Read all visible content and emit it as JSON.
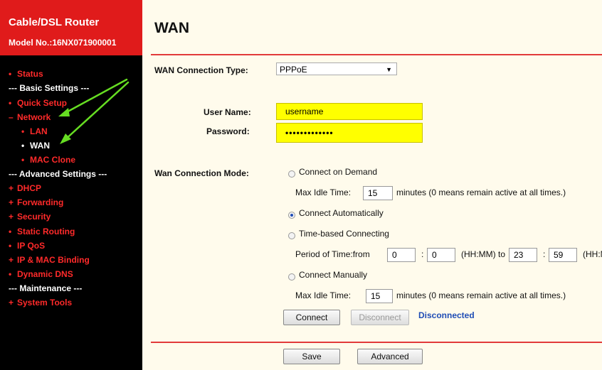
{
  "brand": {
    "title": "Cable/DSL Router",
    "model": "Model No.:16NX071900001"
  },
  "nav": {
    "status": "Status",
    "basic_header": "--- Basic Settings ---",
    "quick_setup": "Quick Setup",
    "network": "Network",
    "lan": "LAN",
    "wan": "WAN",
    "mac_clone": "MAC Clone",
    "advanced_header": "--- Advanced Settings ---",
    "dhcp": "DHCP",
    "forwarding": "Forwarding",
    "security": "Security",
    "static_routing": "Static Routing",
    "ip_qos": "IP QoS",
    "ip_mac_binding": "IP & MAC Binding",
    "dynamic_dns": "Dynamic DNS",
    "maintenance_header": "--- Maintenance ---",
    "system_tools": "System Tools"
  },
  "page": {
    "title": "WAN",
    "wan_type_label": "WAN Connection Type:",
    "wan_type_value": "PPPoE",
    "username_label": "User Name:",
    "username_value": "username",
    "password_label": "Password:",
    "password_value": "•••••••••••••",
    "mode_label": "Wan Connection Mode:",
    "connect_on_demand": "Connect on Demand",
    "max_idle_label": "Max Idle Time:",
    "max_idle_value_1": "15",
    "max_idle_note": "minutes (0 means remain active at all times.)",
    "connect_automatically": "Connect Automatically",
    "time_based": "Time-based Connecting",
    "period_label": "Period of Time:from",
    "from_hh": "0",
    "from_mm": "0",
    "hhmm_to": "(HH:MM) to",
    "to_hh": "23",
    "to_mm": "59",
    "hhmm_end": "(HH:MM)",
    "connect_manually": "Connect Manually",
    "max_idle_value_2": "15",
    "connect_btn": "Connect",
    "disconnect_btn": "Disconnect",
    "status": "Disconnected",
    "save_btn": "Save",
    "advanced_btn": "Advanced"
  },
  "colors": {
    "brand_red": "#e01b1b",
    "nav_red": "#ff2a2a",
    "highlight_yellow": "#ffff00",
    "link_blue": "#1f4db5",
    "arrow_green": "#66dd22"
  }
}
